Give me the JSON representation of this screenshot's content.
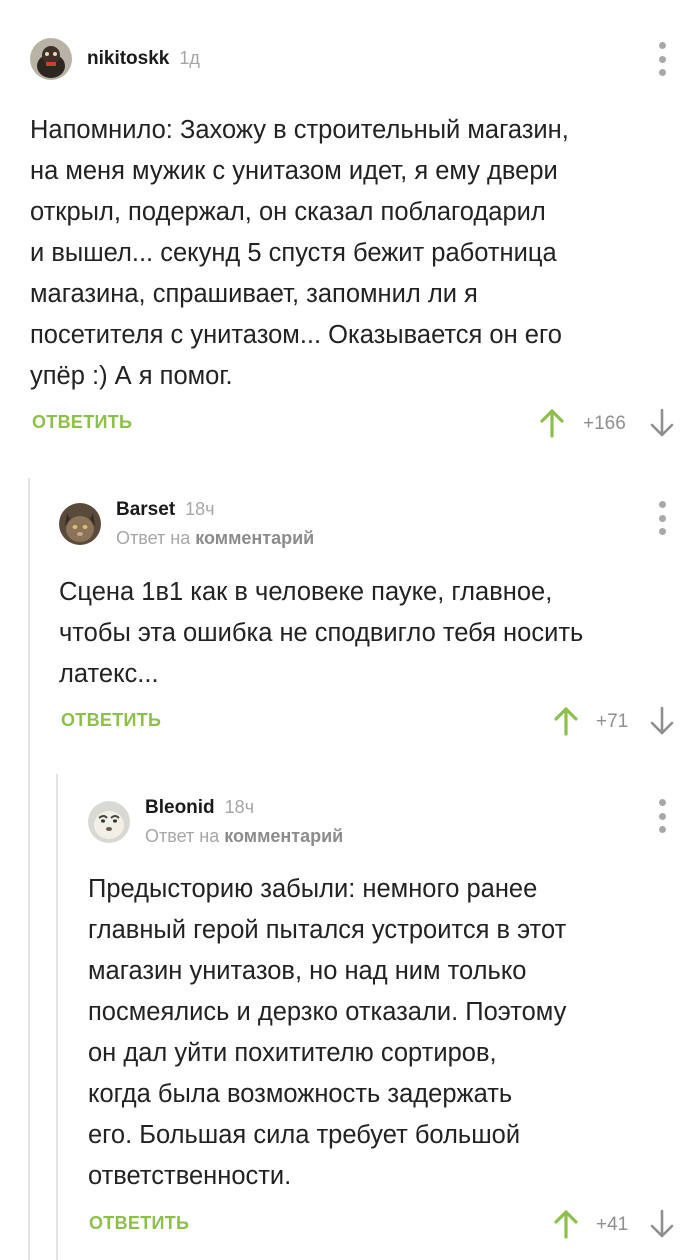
{
  "comments": [
    {
      "username": "nikitoskk",
      "time": "1д",
      "reply_prefix": "",
      "reply_target": "",
      "text": "Напомнило: Захожу в строительный магазин,\nна меня мужик с унитазом идет, я ему двери\nоткрыл, подержал, он сказал поблагодарил\nи вышел... секунд 5 спустя бежит работница\nмагазина, спрашивает, запомнил ли я\nпосетителя с унитазом... Оказывается он его\nупёр :) А я помог.",
      "reply_label": "ОТВЕТИТЬ",
      "rating": "+166"
    },
    {
      "username": "Barset",
      "time": "18ч",
      "reply_prefix": "Ответ на ",
      "reply_target": "комментарий",
      "text": "Сцена 1в1 как в человеке пауке, главное,\nчтобы эта ошибка не сподвигло тебя носить\nлатекс...",
      "reply_label": "ОТВЕТИТЬ",
      "rating": "+71"
    },
    {
      "username": "Bleonid",
      "time": "18ч",
      "reply_prefix": "Ответ на ",
      "reply_target": "комментарий",
      "text": "Предысторию забыли: немного ранее\nглавный герой пытался устроится в этот\nмагазин унитазов, но над ним только\nпосмеялись и дерзко отказали. Поэтому\nон дал уйти похитителю сортиров,\nкогда была возможность задержать\nего. Большая сила требует большой\nответственности.",
      "reply_label": "ОТВЕТИТЬ",
      "rating": "+41"
    }
  ],
  "colors": {
    "accent": "#8dbf4b",
    "muted": "#a6a6a6",
    "thread_line": "#e4e4e4"
  }
}
